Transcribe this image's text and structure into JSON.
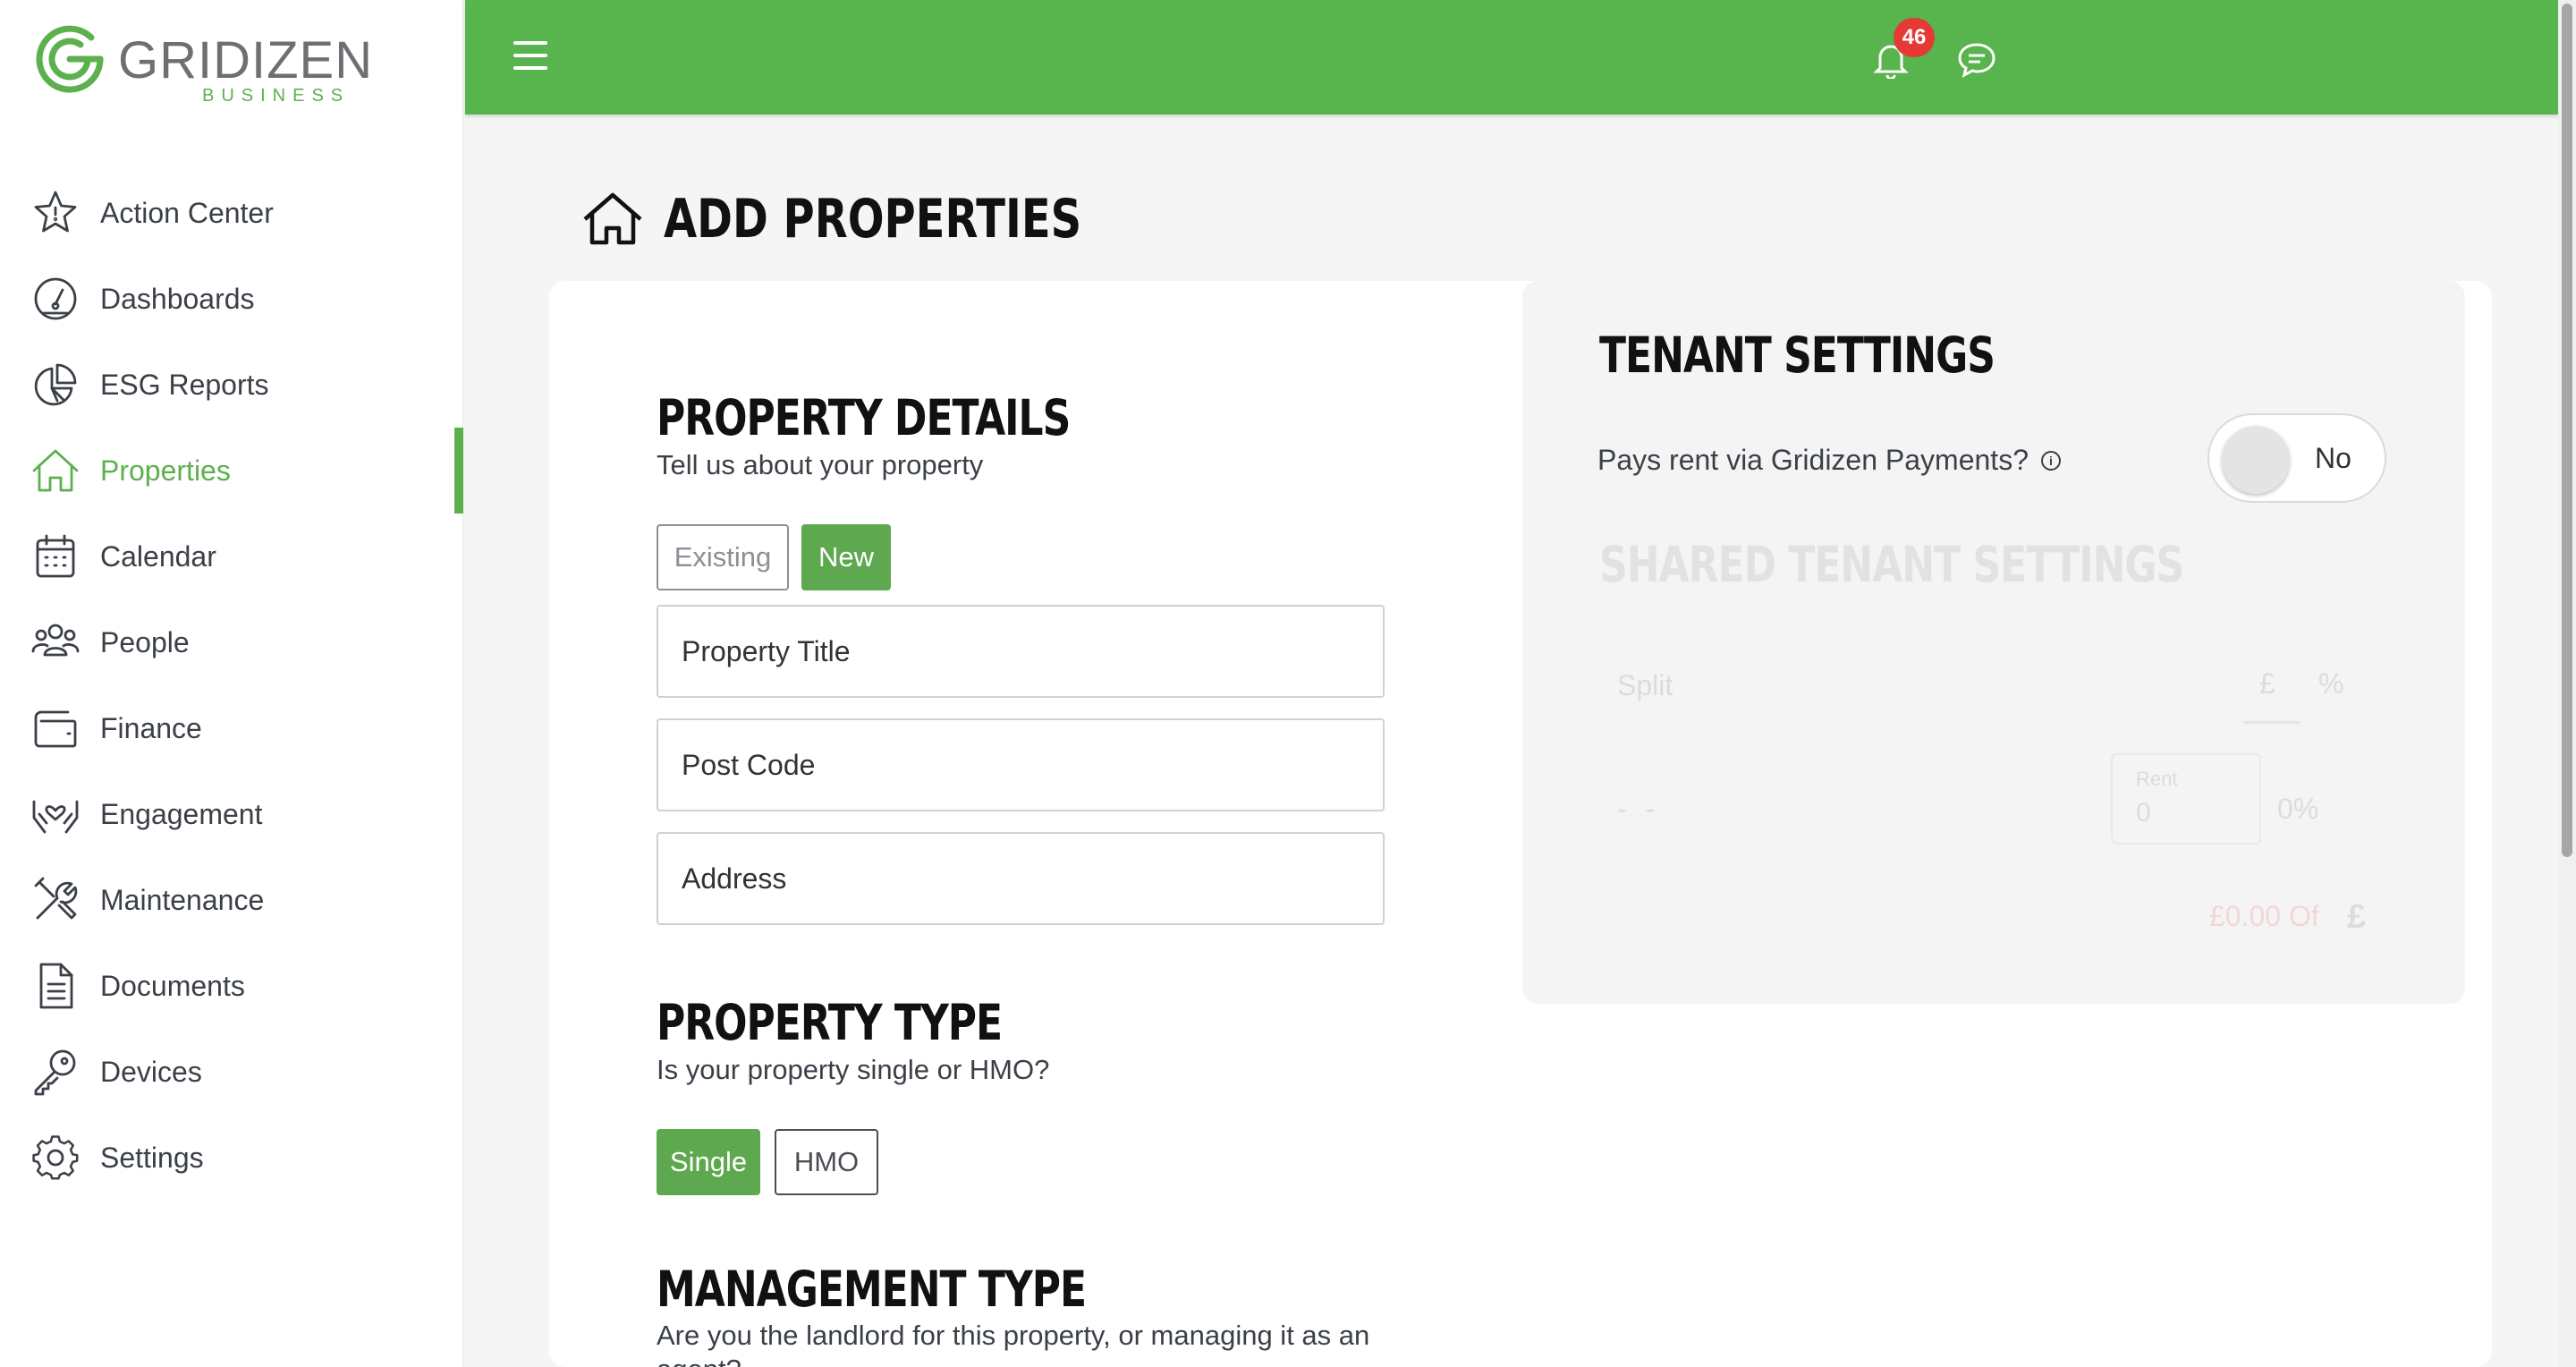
{
  "brand": {
    "name": "GRIDIZEN",
    "sub": "BUSINESS",
    "accent": "#58b44d"
  },
  "sidebar": {
    "items": [
      {
        "label": "Action Center",
        "icon": "star-icon"
      },
      {
        "label": "Dashboards",
        "icon": "gauge-icon"
      },
      {
        "label": "ESG Reports",
        "icon": "pie-chart-icon"
      },
      {
        "label": "Properties",
        "icon": "home-icon",
        "active": true
      },
      {
        "label": "Calendar",
        "icon": "calendar-icon"
      },
      {
        "label": "People",
        "icon": "people-icon"
      },
      {
        "label": "Finance",
        "icon": "wallet-icon"
      },
      {
        "label": "Engagement",
        "icon": "hands-heart-icon"
      },
      {
        "label": "Maintenance",
        "icon": "tools-icon"
      },
      {
        "label": "Documents",
        "icon": "document-icon"
      },
      {
        "label": "Devices",
        "icon": "key-icon"
      },
      {
        "label": "Settings",
        "icon": "gear-icon"
      }
    ]
  },
  "topbar": {
    "notification_count": "46"
  },
  "page": {
    "title": "ADD PROPERTIES"
  },
  "property_details": {
    "heading": "PROPERTY DETAILS",
    "subtitle": "Tell us about your property",
    "existing_label": "Existing",
    "new_label": "New",
    "title_placeholder": "Property Title",
    "postcode_placeholder": "Post Code",
    "address_placeholder": "Address"
  },
  "property_type": {
    "heading": "PROPERTY TYPE",
    "subtitle": "Is your property single or HMO?",
    "single_label": "Single",
    "hmo_label": "HMO"
  },
  "management_type": {
    "heading": "MANAGEMENT TYPE",
    "subtitle": "Are you the landlord for this property, or managing it as an agent?"
  },
  "tenant_settings": {
    "heading": "TENANT SETTINGS",
    "pays_rent_label": "Pays rent via Gridizen Payments?",
    "toggle_label": "No",
    "shared_heading": "SHARED TENANT SETTINGS",
    "split_label": "Split",
    "pound_tab": "£",
    "percent_tab": "%",
    "dash": "- -",
    "rent_label": "Rent",
    "rent_value": "0",
    "rent_percent": "0%",
    "total_text": "£0.00 Of",
    "total_symbol": "£"
  }
}
